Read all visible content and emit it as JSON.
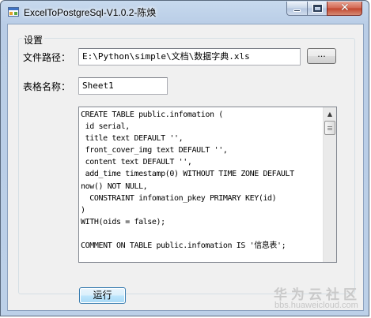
{
  "window": {
    "title": "ExcelToPostgreSql-V1.0.2-陈焕",
    "icon": "app-window-icon",
    "controls": {
      "minimize": "minimize-icon",
      "maximize": "maximize-icon",
      "close": "close-icon"
    }
  },
  "settings": {
    "group_label": "设置",
    "file_path_label": "文件路径：",
    "file_path_value": "E:\\Python\\simple\\文档\\数据字典.xls",
    "browse_label": "...",
    "sheet_name_label": "表格名称：",
    "sheet_name_value": "Sheet1",
    "sql_output": [
      "CREATE TABLE public.infomation (",
      " id serial,",
      " title text DEFAULT '',",
      " front_cover_img text DEFAULT '',",
      " content text DEFAULT '',",
      " add_time timestamp(0) WITHOUT TIME ZONE DEFAULT",
      "now() NOT NULL,",
      "  CONSTRAINT infomation_pkey PRIMARY KEY(id)",
      ")",
      "WITH(oids = false);",
      "",
      "COMMENT ON TABLE public.infomation IS '信息表';"
    ]
  },
  "actions": {
    "run_label": "运行"
  },
  "watermark": {
    "main": "华为云社区",
    "sub": "bbs.huaweicloud.com"
  },
  "colors": {
    "titlebar": "#bcd0e8",
    "client_bg": "#f0f0f0",
    "close_button": "#c2452c",
    "run_button_border": "#3c7fb1"
  }
}
